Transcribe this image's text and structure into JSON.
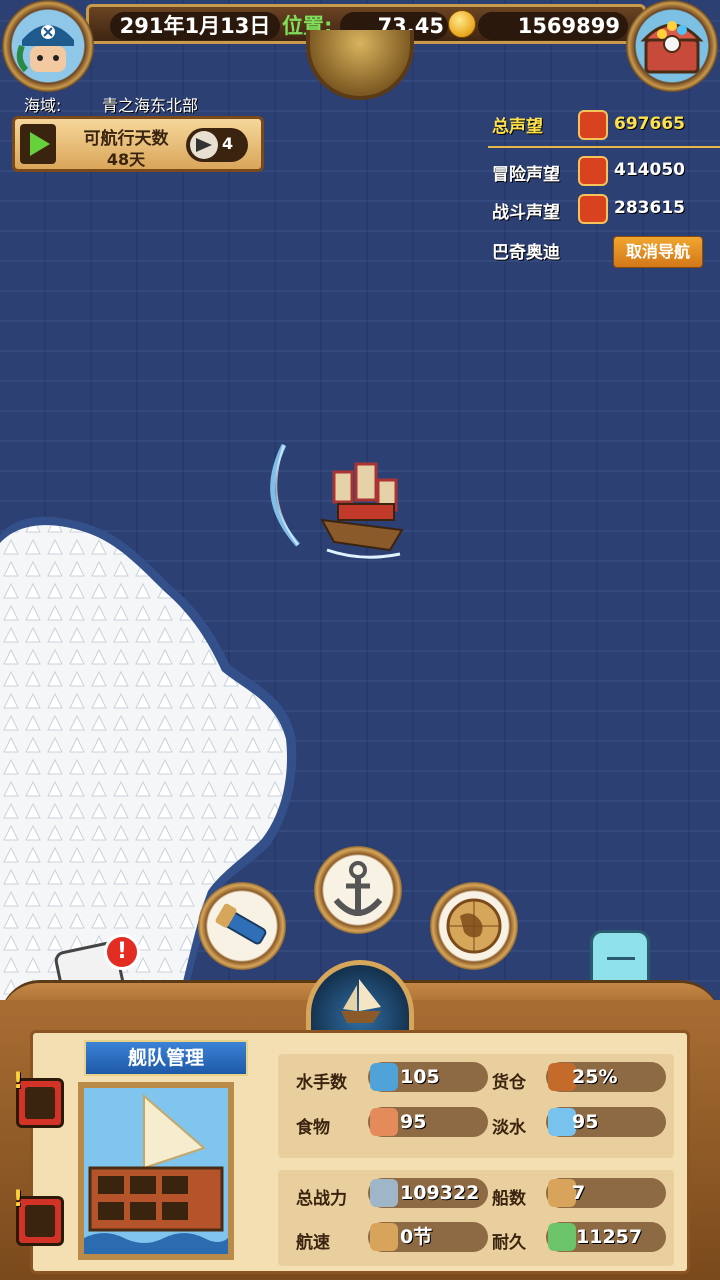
{
  "top": {
    "date": "291年1月13日",
    "position_label": "位置:",
    "position_value": "73,45",
    "gold": "1569899"
  },
  "region": {
    "label": "海域:",
    "value": "青之海东北部"
  },
  "sail_panel": {
    "title": "可航行天数",
    "days": "48天",
    "wind_level": "4"
  },
  "reputation": {
    "total_label": "总声望",
    "total_value": "697665",
    "adventure_label": "冒险声望",
    "adventure_value": "414050",
    "battle_label": "战斗声望",
    "battle_value": "283615",
    "destination": "巴奇奥迪",
    "cancel_nav": "取消导航"
  },
  "fleet": {
    "title": "舰队管理",
    "stats": [
      {
        "label": "水手数",
        "value": "105",
        "icon": "sailor-icon"
      },
      {
        "label": "货仓",
        "value": "25%",
        "icon": "cargo-icon"
      },
      {
        "label": "食物",
        "value": "95",
        "icon": "meat-icon"
      },
      {
        "label": "淡水",
        "value": "95",
        "icon": "water-icon"
      },
      {
        "label": "总战力",
        "value": "109322",
        "icon": "crossed-swords-icon"
      },
      {
        "label": "船数",
        "value": "7",
        "icon": "boat-icon"
      },
      {
        "label": "航速",
        "value": "0节",
        "icon": "speed-boat-icon"
      },
      {
        "label": "耐久",
        "value": "11257",
        "icon": "repair-icon"
      }
    ]
  },
  "colors": {
    "sea": "#2c4074",
    "total_rep": "#ffe14a",
    "accent_orange": "#e08b23",
    "stat_green": "#7ee05a"
  }
}
